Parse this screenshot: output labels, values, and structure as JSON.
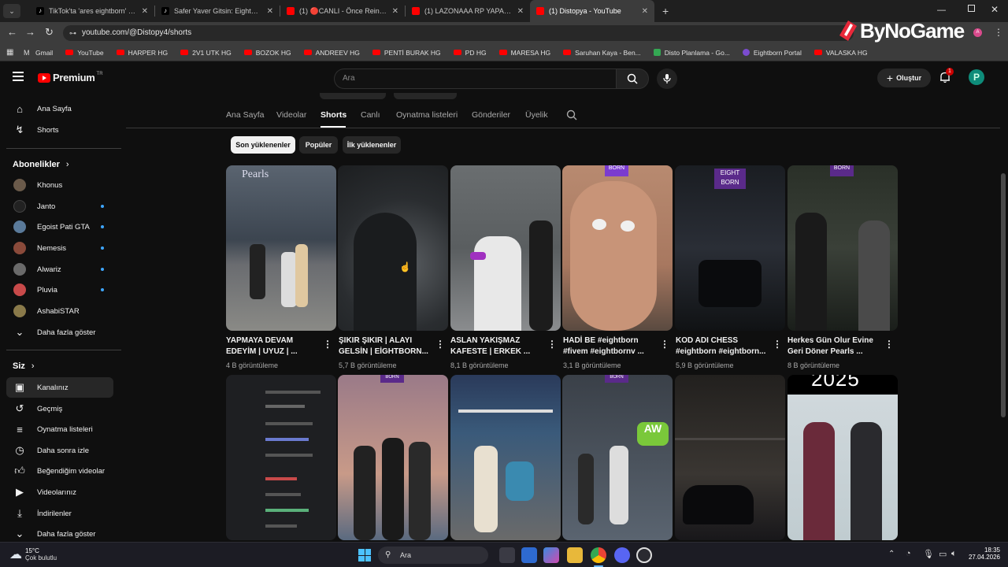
{
  "browser": {
    "tabs": [
      {
        "title": "TikTok'ta 'ares eightborn' bulab",
        "icon": "tiktok-icon"
      },
      {
        "title": "Safer Yaver Gitsin: Eightborn ve",
        "icon": "tiktok-icon"
      },
      {
        "title": "(1) 🔴CANLI - Önce Reinar son",
        "icon": "youtube-icon"
      },
      {
        "title": "(1) LAZONAAA RP YAPARKEN Y",
        "icon": "youtube-icon"
      },
      {
        "title": "(1) Distopya - YouTube",
        "icon": "youtube-icon",
        "active": true
      }
    ],
    "url": "youtube.com/@Distopy4/shorts",
    "bookmarks": [
      {
        "label": "Gmail",
        "icon": "gmail-icon"
      },
      {
        "label": "YouTube",
        "icon": "youtube-icon"
      },
      {
        "label": "HARPER HG",
        "icon": "youtube-icon"
      },
      {
        "label": "2V1 UTK HG",
        "icon": "youtube-icon"
      },
      {
        "label": "BOZOK HG",
        "icon": "youtube-icon"
      },
      {
        "label": "ANDREEV HG",
        "icon": "youtube-icon"
      },
      {
        "label": "PENTİ BURAK HG",
        "icon": "youtube-icon"
      },
      {
        "label": "PD HG",
        "icon": "youtube-icon"
      },
      {
        "label": "MARESA HG",
        "icon": "youtube-icon"
      },
      {
        "label": "Saruhan Kaya - Ben...",
        "icon": "youtube-icon"
      },
      {
        "label": "Disto Planlama - Go...",
        "icon": "sheets-icon"
      },
      {
        "label": "Eightborn Portal",
        "icon": "eightborn-icon"
      },
      {
        "label": "VALASKA HG",
        "icon": "youtube-icon"
      }
    ],
    "watermark": "ByNoGame"
  },
  "youtube": {
    "logo": "Premium",
    "logo_sup": "TR",
    "search_placeholder": "Ara",
    "create_label": "Oluştur",
    "notification_count": "1",
    "sidebar": {
      "main": [
        {
          "label": "Ana Sayfa",
          "icon": "home-icon"
        },
        {
          "label": "Shorts",
          "icon": "shorts-icon"
        }
      ],
      "subscriptions_title": "Abonelikler",
      "subscriptions": [
        {
          "label": "Khonus",
          "color": "#6a5a4a",
          "dot": false
        },
        {
          "label": "Janto",
          "color": "#222222",
          "dot": true
        },
        {
          "label": "Egoist Pati GTA",
          "color": "#5a7a9a",
          "dot": true
        },
        {
          "label": "Nemesis",
          "color": "#8a4a3a",
          "dot": true
        },
        {
          "label": "Alwariz",
          "color": "#6a6a6a",
          "dot": true
        },
        {
          "label": "Pluvia",
          "color": "#c84a4a",
          "dot": true
        },
        {
          "label": "AshabiSTAR",
          "color": "#8a7a4a",
          "dot": false
        }
      ],
      "show_more_subs": "Daha fazla göster",
      "you_title": "Siz",
      "you": [
        {
          "label": "Kanalınız",
          "icon": "channel-icon",
          "active": true
        },
        {
          "label": "Geçmiş",
          "icon": "history-icon"
        },
        {
          "label": "Oynatma listeleri",
          "icon": "playlists-icon"
        },
        {
          "label": "Daha sonra izle",
          "icon": "watch-later-icon"
        },
        {
          "label": "Beğendiğim videolar",
          "icon": "like-icon"
        },
        {
          "label": "Videolarınız",
          "icon": "your-videos-icon"
        },
        {
          "label": "İndirilenler",
          "icon": "download-icon"
        },
        {
          "label": "Daha fazla göster",
          "icon": "chevron-down-icon"
        }
      ]
    },
    "channel_tabs": [
      "Ana Sayfa",
      "Videolar",
      "Shorts",
      "Canlı",
      "Oynatma listeleri",
      "Gönderiler",
      "Üyelik"
    ],
    "active_tab": "Shorts",
    "filters": [
      "Son yüklenenler",
      "Popüler",
      "İlk yüklenenler"
    ],
    "active_filter": "Son yüklenenler",
    "shorts_row1": [
      {
        "title": "YAPMAYA DEVAM EDEYİM | UYUZ | ...",
        "views": "4 B görüntüleme",
        "bg": "#5a6470",
        "accent": "#2c3440"
      },
      {
        "title": "ŞIKIR ŞIKIR | ALAYI GELSİN | EİGHTBORN...",
        "views": "5,7 B görüntüleme",
        "bg": "#2a2d30",
        "accent": "#7a7e82"
      },
      {
        "title": "ASLAN YAKIŞMAZ KAFESTE | ERKEK ...",
        "views": "8,1 B görüntüleme",
        "bg": "#6a6e70",
        "accent": "#3a3e40"
      },
      {
        "title": "HADİ BE  #eightborn #fivem #eightbornv ...",
        "views": "3,1 B görüntüleme",
        "bg": "#b88a70",
        "accent": "#4a3a30"
      },
      {
        "title": "KOD ADI CHESS #eightborn #eightborn...",
        "views": "5,9 B görüntüleme",
        "bg": "#1a1d22",
        "accent": "#3a3e48"
      },
      {
        "title": "Herkes Gün Olur Evine Geri Döner  Pearls ...",
        "views": "8 B görüntüleme",
        "bg": "#2a3028",
        "accent": "#4a5a48"
      }
    ],
    "shorts_row2": [
      {
        "bg": "#1e1f22",
        "accent": "#2b2d31"
      },
      {
        "bg": "#9a7a88",
        "accent": "#c89a88"
      },
      {
        "bg": "#3a5a7a",
        "accent": "#6a6a6a"
      },
      {
        "bg": "#3a4048",
        "accent": "#5a6470"
      },
      {
        "bg": "#22201e",
        "accent": "#3a3632"
      },
      {
        "bg": "#d0d8dc",
        "accent": "#6a2a3a",
        "top_text": "2025"
      }
    ]
  },
  "taskbar": {
    "weather_temp": "15°C",
    "weather_desc": "Çok bulutlu",
    "search_label": "Ara",
    "time": "18:35",
    "date": "27.04.2026"
  }
}
